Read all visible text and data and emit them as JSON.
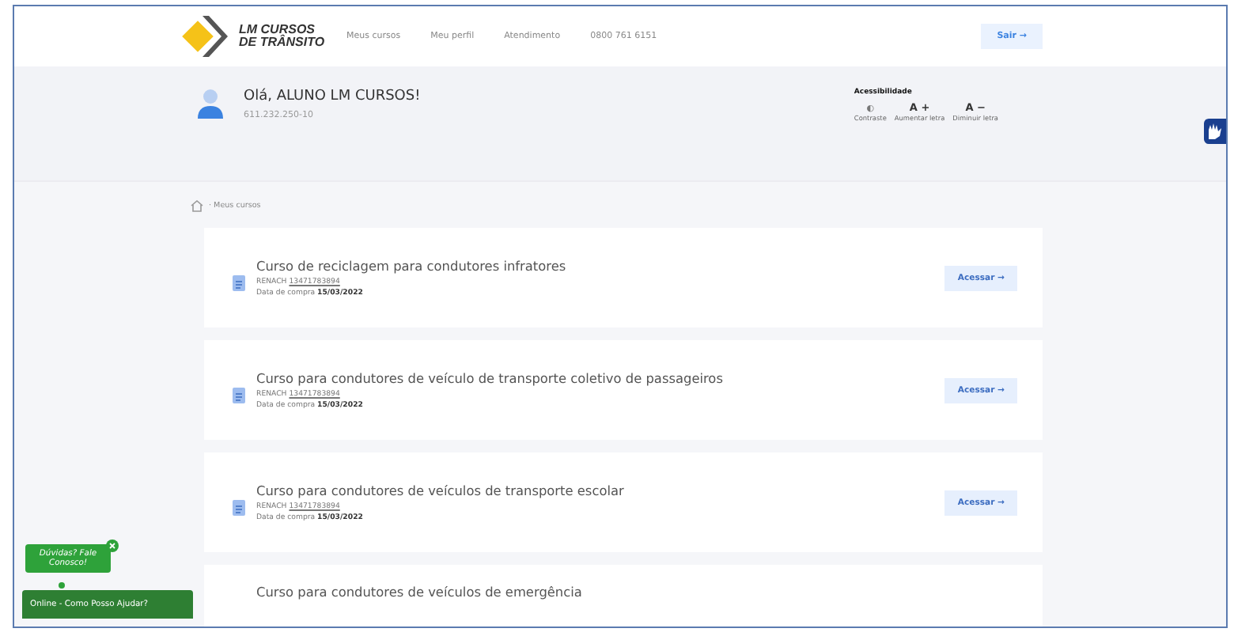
{
  "header": {
    "logo_line_1": "LM CURSOS",
    "logo_line_2": "DE TRÂNSITO",
    "nav": [
      {
        "label": "Meus cursos"
      },
      {
        "label": "Meu perfil"
      },
      {
        "label": "Atendimento"
      },
      {
        "label": "0800 761 6151"
      }
    ],
    "logout": "Sair →"
  },
  "user": {
    "greeting": "Olá, ALUNO LM CURSOS!",
    "document": "611.232.250-10"
  },
  "accessibility": {
    "title": "Acessibilidade",
    "options": [
      {
        "kind": "contrast",
        "icon": "◐",
        "label": "Contraste"
      },
      {
        "kind": "bigger",
        "icon": "A +",
        "label": "Aumentar letra"
      },
      {
        "kind": "smaller",
        "icon": "A −",
        "label": "Diminuir letra"
      }
    ]
  },
  "breadcrumb": "· Meus cursos",
  "courses": [
    {
      "title": "Curso de reciclagem para condutores infratores",
      "renach_label": "RENACH",
      "renach": "13471783894",
      "date_label": "Data de compra",
      "date": "15/03/2022",
      "button": "Acessar →"
    },
    {
      "title": "Curso para condutores de veículo de transporte coletivo de passageiros",
      "renach_label": "RENACH",
      "renach": "13471783894",
      "date_label": "Data de compra",
      "date": "15/03/2022",
      "button": "Acessar →"
    },
    {
      "title": "Curso para condutores de veículos de transporte escolar",
      "renach_label": "RENACH",
      "renach": "13471783894",
      "date_label": "Data de compra",
      "date": "15/03/2022",
      "button": "Acessar →"
    },
    {
      "title": "Curso para condutores de veículos de emergência"
    }
  ],
  "chat": {
    "bubble": "Dúvidas? Fale Conosco!",
    "bar": "Online - Como Posso Ajudar?"
  }
}
